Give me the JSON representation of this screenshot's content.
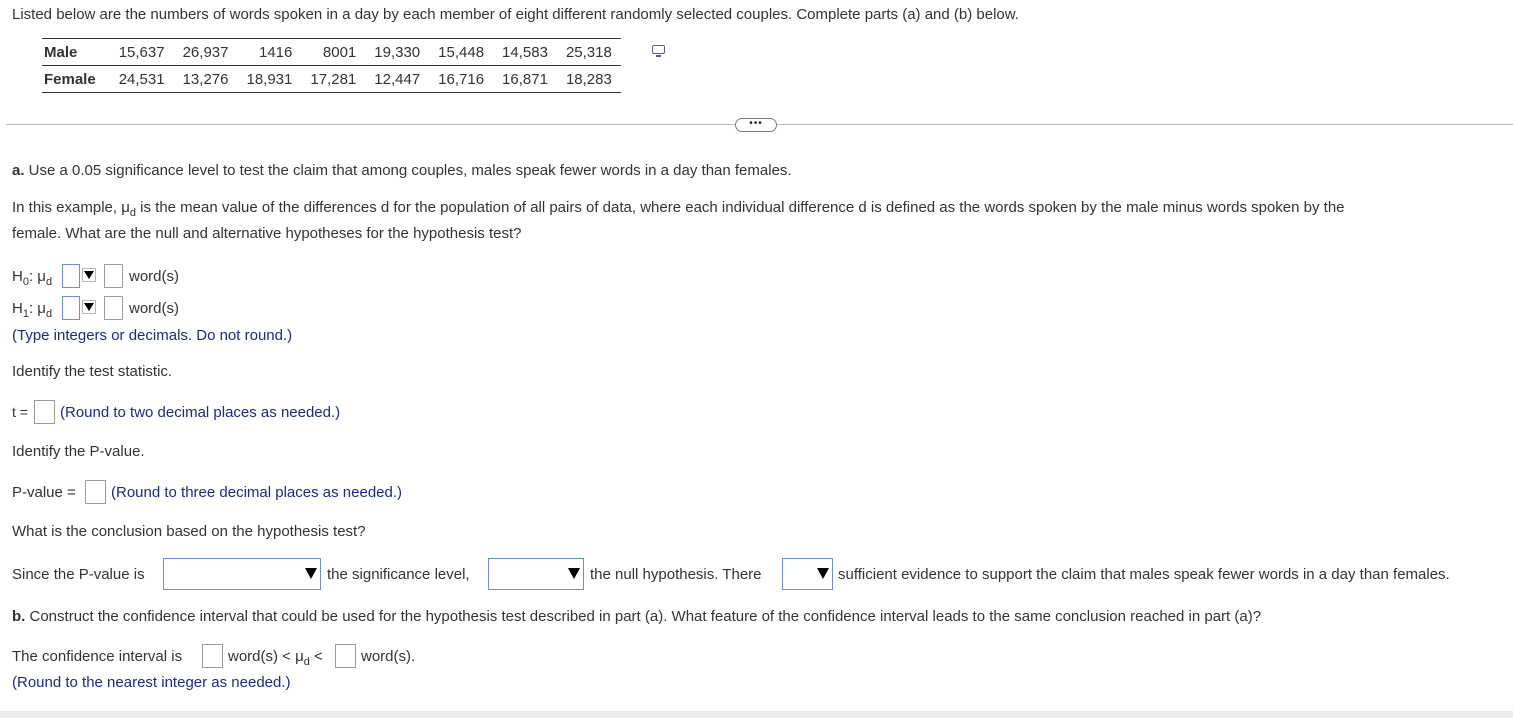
{
  "intro": "Listed below are the numbers of words spoken in a day by each member of eight different randomly selected couples. Complete parts (a) and (b) below.",
  "table": {
    "rows": [
      {
        "label": "Male",
        "values": [
          "15,637",
          "26,937",
          "1416",
          "8001",
          "19,330",
          "15,448",
          "14,583",
          "25,318"
        ]
      },
      {
        "label": "Female",
        "values": [
          "24,531",
          "13,276",
          "18,931",
          "17,281",
          "12,447",
          "16,716",
          "16,871",
          "18,283"
        ]
      }
    ]
  },
  "more_button": "•••",
  "part_a": {
    "label": "a.",
    "text": " Use a 0.05 significance level to test the claim that among couples, males speak fewer words in a day than females.",
    "example_1": "In this example, μ",
    "example_sub": "d",
    "example_2": " is the mean value of the differences d for the population of all pairs of data, where each individual difference d is defined as the words spoken by the male minus words spoken by the",
    "example_3": "female. What are the null and alternative hypotheses for the hypothesis test?",
    "h0_label": "H",
    "h0_sub": "0",
    "h1_label": "H",
    "h1_sub": "1",
    "mu": ": μ",
    "mu_sub": "d",
    "unit": "word(s)",
    "hyp_hint": "(Type integers or decimals. Do not round.)",
    "test_stat_prompt": "Identify the test statistic.",
    "t_label": "t =",
    "t_hint": "(Round to two decimal places as needed.)",
    "pvalue_prompt": "Identify the P-value.",
    "pvalue_label": "P-value =",
    "pvalue_hint": "(Round to three decimal places as needed.)",
    "conclusion_prompt": "What is the conclusion based on the hypothesis test?",
    "since": "Since the P-value is",
    "sig_level": "the significance level,",
    "null_hyp": "the null hypothesis. There",
    "sufficient": "sufficient evidence to support the claim that males speak fewer words in a day than females."
  },
  "part_b": {
    "label": "b.",
    "text": " Construct the confidence interval that could be used for the hypothesis test described in part (a). What feature of the confidence interval leads to the same conclusion reached in part (a)?",
    "ci_label": "The confidence interval is",
    "ci_mid": "word(s) < μ",
    "ci_sub": "d",
    "ci_lt": " <",
    "ci_end": "word(s).",
    "ci_hint": "(Round to the nearest integer as needed.)"
  }
}
